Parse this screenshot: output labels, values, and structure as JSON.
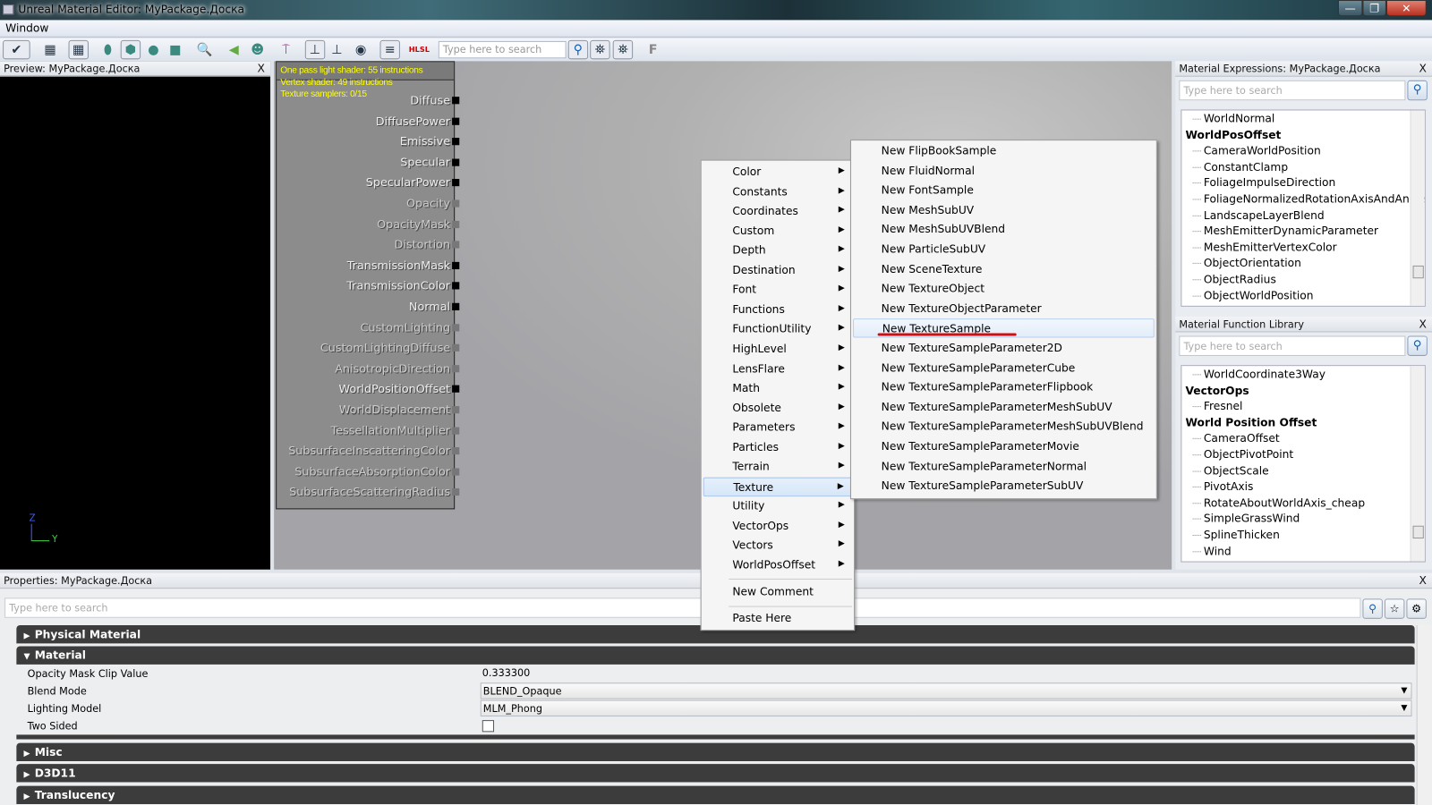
{
  "window": {
    "title": "Unreal Material Editor: MyPackage.Доска",
    "minimize": "—",
    "restore": "❐",
    "close": "✕"
  },
  "menubar": {
    "items": [
      "Window"
    ]
  },
  "toolbar": {
    "search_placeholder": "Type here to search",
    "buttons": [
      "apply-icon",
      "home-icon",
      "grid-icon",
      "cylinder-icon",
      "cube-icon",
      "sphere-icon",
      "plane-icon",
      "zoom-icon",
      "back-icon",
      "skull-icon",
      "move-up-icon",
      "connectors-icon",
      "connectors-alt-icon",
      "realtime-preview-icon",
      "stats-icon",
      "hlsl-icon",
      "find-icon",
      "binoculars-down-icon",
      "binoculars-up-icon",
      "font-icon"
    ]
  },
  "preview": {
    "title": "Preview: MyPackage.Доска",
    "close": "X",
    "axis_z": "Z",
    "axis_y": "Y"
  },
  "node": {
    "stats": [
      "One pass light shader: 55 instructions",
      "Vertex shader: 49 instructions",
      "Texture samplers: 0/15"
    ],
    "pins": [
      {
        "label": "Diffuse",
        "active": true
      },
      {
        "label": "DiffusePower",
        "active": true
      },
      {
        "label": "Emissive",
        "active": true
      },
      {
        "label": "Specular",
        "active": true
      },
      {
        "label": "SpecularPower",
        "active": true
      },
      {
        "label": "Opacity",
        "active": false
      },
      {
        "label": "OpacityMask",
        "active": false
      },
      {
        "label": "Distortion",
        "active": false
      },
      {
        "label": "TransmissionMask",
        "active": true
      },
      {
        "label": "TransmissionColor",
        "active": true
      },
      {
        "label": "Normal",
        "active": true
      },
      {
        "label": "CustomLighting",
        "active": false
      },
      {
        "label": "CustomLightingDiffuse",
        "active": false
      },
      {
        "label": "AnisotropicDirection",
        "active": false
      },
      {
        "label": "WorldPositionOffset",
        "active": true
      },
      {
        "label": "WorldDisplacement",
        "active": false
      },
      {
        "label": "TessellationMultiplier",
        "active": false
      },
      {
        "label": "SubsurfaceInscatteringColor",
        "active": false
      },
      {
        "label": "SubsurfaceAbsorptionColor",
        "active": false
      },
      {
        "label": "SubsurfaceScatteringRadius",
        "active": false
      }
    ]
  },
  "context_menu": {
    "items": [
      "Color",
      "Constants",
      "Coordinates",
      "Custom",
      "Depth",
      "Destination",
      "Font",
      "Functions",
      "FunctionUtility",
      "HighLevel",
      "LensFlare",
      "Math",
      "Obsolete",
      "Parameters",
      "Particles",
      "Terrain",
      "Texture",
      "Utility",
      "VectorOps",
      "Vectors",
      "WorldPosOffset"
    ],
    "selected": "Texture",
    "extra": [
      "New Comment",
      "Paste Here"
    ]
  },
  "submenu": {
    "items": [
      "New FlipBookSample",
      "New FluidNormal",
      "New FontSample",
      "New MeshSubUV",
      "New MeshSubUVBlend",
      "New ParticleSubUV",
      "New SceneTexture",
      "New TextureObject",
      "New TextureObjectParameter",
      "New TextureSample",
      "New TextureSampleParameter2D",
      "New TextureSampleParameterCube",
      "New TextureSampleParameterFlipbook",
      "New TextureSampleParameterMeshSubUV",
      "New TextureSampleParameterMeshSubUVBlend",
      "New TextureSampleParameterMovie",
      "New TextureSampleParameterNormal",
      "New TextureSampleParameterSubUV"
    ],
    "highlighted": "New TextureSample",
    "annotation_color": "#d01010"
  },
  "expressions": {
    "title": "Material Expressions: MyPackage.Доска",
    "close": "X",
    "search_placeholder": "Type here to search",
    "items": [
      {
        "t": "WorldNormal",
        "b": false
      },
      {
        "t": "WorldPosOffset",
        "b": true
      },
      {
        "t": "CameraWorldPosition",
        "b": false
      },
      {
        "t": "ConstantClamp",
        "b": false
      },
      {
        "t": "FoliageImpulseDirection",
        "b": false
      },
      {
        "t": "FoliageNormalizedRotationAxisAndAngle",
        "b": false
      },
      {
        "t": "LandscapeLayerBlend",
        "b": false
      },
      {
        "t": "MeshEmitterDynamicParameter",
        "b": false
      },
      {
        "t": "MeshEmitterVertexColor",
        "b": false
      },
      {
        "t": "ObjectOrientation",
        "b": false
      },
      {
        "t": "ObjectRadius",
        "b": false
      },
      {
        "t": "ObjectWorldPosition",
        "b": false
      }
    ]
  },
  "function_library": {
    "title": "Material Function Library",
    "close": "X",
    "search_placeholder": "Type here to search",
    "items": [
      {
        "t": "WorldCoordinate3Way",
        "b": false
      },
      {
        "t": "VectorOps",
        "b": true
      },
      {
        "t": "Fresnel",
        "b": false
      },
      {
        "t": "World Position Offset",
        "b": true
      },
      {
        "t": "CameraOffset",
        "b": false
      },
      {
        "t": "ObjectPivotPoint",
        "b": false
      },
      {
        "t": "ObjectScale",
        "b": false
      },
      {
        "t": "PivotAxis",
        "b": false
      },
      {
        "t": "RotateAboutWorldAxis_cheap",
        "b": false
      },
      {
        "t": "SimpleGrassWind",
        "b": false
      },
      {
        "t": "SplineThicken",
        "b": false
      },
      {
        "t": "Wind",
        "b": false
      }
    ]
  },
  "properties": {
    "title": "Properties: MyPackage.Доска",
    "close": "X",
    "search_placeholder": "Type here to search",
    "categories": {
      "physical": "Physical Material",
      "material": "Material",
      "misc": "Misc",
      "d3d11": "D3D11",
      "translucency": "Translucency"
    },
    "rows": [
      {
        "label": "Opacity Mask Clip Value",
        "value": "0.333300"
      },
      {
        "label": "Blend Mode",
        "value": "BLEND_Opaque"
      },
      {
        "label": "Lighting Model",
        "value": "MLM_Phong"
      },
      {
        "label": "Two Sided",
        "value": false
      }
    ]
  }
}
